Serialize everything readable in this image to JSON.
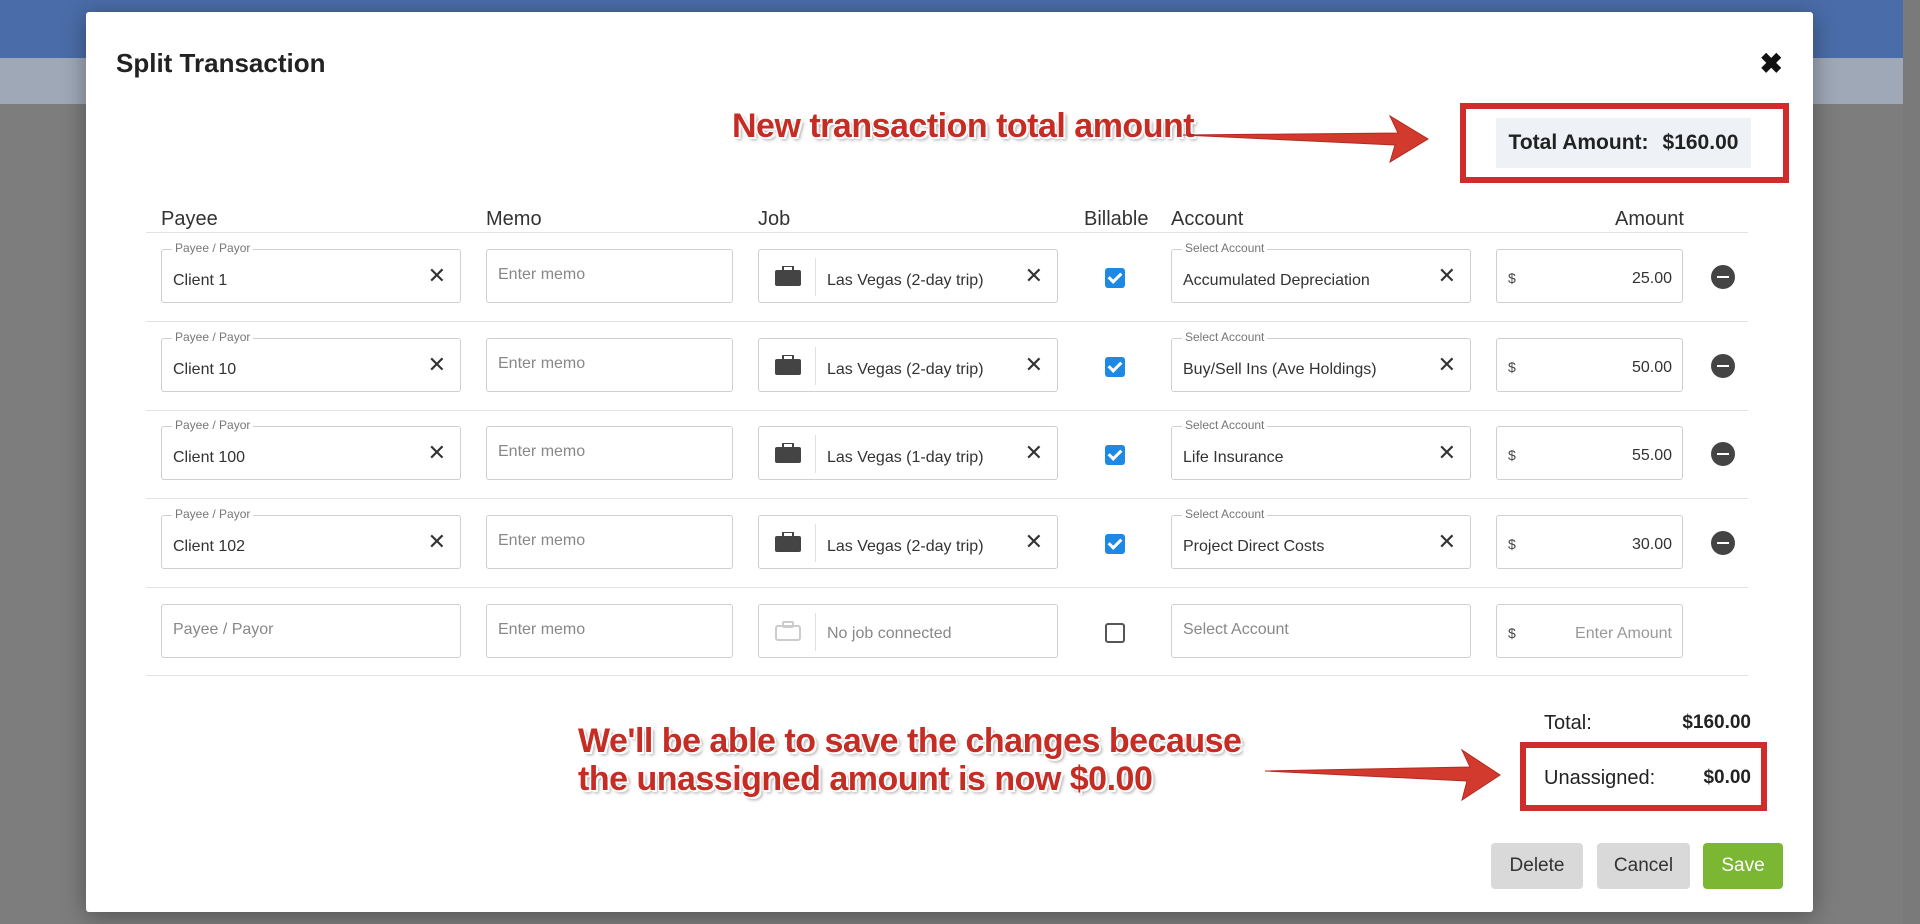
{
  "dialog": {
    "title": "Split Transaction",
    "close_icon": "close-icon"
  },
  "total_amount": {
    "label": "Total Amount:",
    "value": "$160.00"
  },
  "headers": {
    "payee": "Payee",
    "memo": "Memo",
    "job": "Job",
    "billable": "Billable",
    "account": "Account",
    "amount": "Amount"
  },
  "field_labels": {
    "payee": "Payee / Payor",
    "account": "Select Account",
    "memo_placeholder": "Enter memo"
  },
  "rows": [
    {
      "payee": "Client 1",
      "job": "Las Vegas (2-day trip)",
      "billable": true,
      "account": "Accumulated Depreciation",
      "currency": "$",
      "amount": "25.00"
    },
    {
      "payee": "Client 10",
      "job": "Las Vegas (2-day trip)",
      "billable": true,
      "account": "Buy/Sell Ins (Ave Holdings)",
      "currency": "$",
      "amount": "50.00"
    },
    {
      "payee": "Client 100",
      "job": "Las Vegas (1-day trip)",
      "billable": true,
      "account": "Life Insurance",
      "currency": "$",
      "amount": "55.00"
    },
    {
      "payee": "Client 102",
      "job": "Las Vegas (2-day trip)",
      "billable": true,
      "account": "Project Direct Costs",
      "currency": "$",
      "amount": "30.00"
    }
  ],
  "new_row": {
    "payee_placeholder": "Payee / Payor",
    "memo_placeholder": "Enter memo",
    "job_placeholder": "No job connected",
    "billable": false,
    "account_placeholder": "Select Account",
    "currency": "$",
    "amount_placeholder": "Enter Amount"
  },
  "summary": {
    "total_label": "Total:",
    "total_value": "$160.00",
    "unassigned_label": "Unassigned:",
    "unassigned_value": "$0.00"
  },
  "buttons": {
    "delete": "Delete",
    "cancel": "Cancel",
    "save": "Save"
  },
  "annotations": {
    "top": "New transaction total amount",
    "bottom_line1": "We'll be able to save the changes because",
    "bottom_line2": "the unassigned amount is now $0.00"
  },
  "colors": {
    "annotation": "#d12c2c",
    "save": "#7cb733",
    "checkbox": "#1e88e5"
  }
}
